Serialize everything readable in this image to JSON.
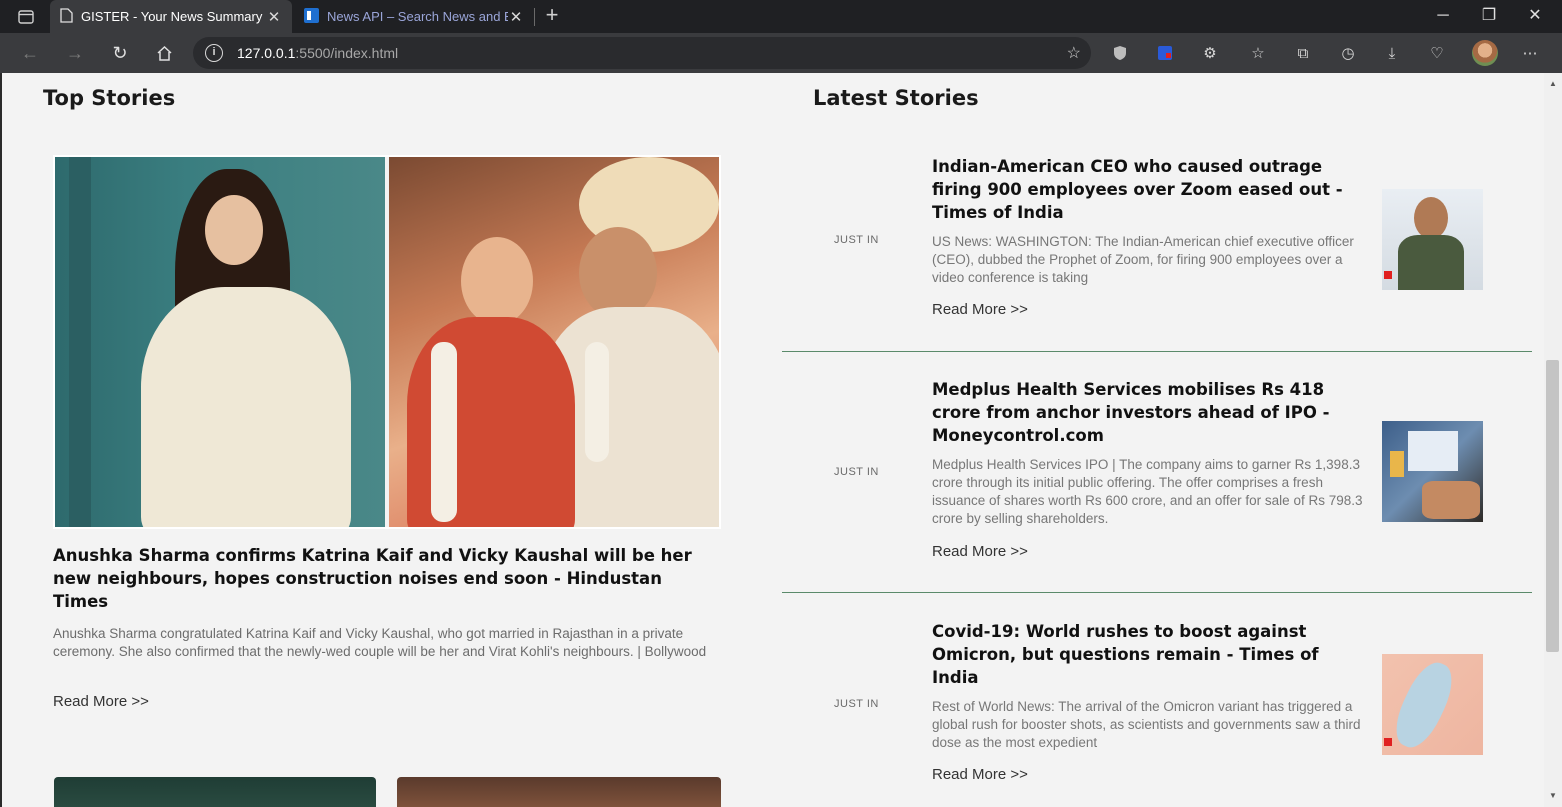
{
  "browser": {
    "tabs": [
      {
        "title": "GISTER - Your News Summary",
        "active": true
      },
      {
        "title": "News API – Search News and Blo",
        "active": false
      }
    ],
    "address": {
      "host": "127.0.0.1",
      "path": ":5500/index.html"
    }
  },
  "page": {
    "top_stories": {
      "heading": "Top Stories",
      "main": {
        "title": "Anushka Sharma confirms Katrina Kaif and Vicky Kaushal will be her new neighbours, hopes construction noises end soon - Hindustan Times",
        "description": "Anushka Sharma congratulated Katrina Kaif and Vicky Kaushal, who got married in Rajasthan in a private ceremony. She also confirmed that the newly-wed couple will be her and Virat Kohli's neighbours. | Bollywood",
        "read_more": "Read More >>"
      }
    },
    "latest_stories": {
      "heading": "Latest Stories",
      "items": [
        {
          "tag": "JUST IN",
          "title": "Indian-American CEO who caused outrage firing 900 employees over Zoom eased out - Times of India",
          "description": "US News: WASHINGTON: The Indian-American chief executive officer (CEO), dubbed the Prophet of Zoom, for firing 900 employees over a video conference is taking",
          "read_more": "Read More >>"
        },
        {
          "tag": "JUST IN",
          "title": "Medplus Health Services mobilises Rs 418 crore from anchor investors ahead of IPO - Moneycontrol.com",
          "description": "Medplus Health Services IPO | The company aims to garner Rs 1,398.3 crore through its initial public offering. The offer comprises a fresh issuance of shares worth Rs 600 crore, and an offer for sale of Rs 798.3 crore by selling shareholders.",
          "read_more": "Read More >>"
        },
        {
          "tag": "JUST IN",
          "title": "Covid-19: World rushes to boost against Omicron, but questions remain - Times of India",
          "description": "Rest of World News: The arrival of the Omicron variant has triggered a global rush for booster shots, as scientists and governments saw a third dose as the most expedient",
          "read_more": "Read More >>"
        }
      ]
    }
  },
  "colors": {
    "tabbar": "#1f2023",
    "toolbar": "#3a3b3e",
    "page_background": "#f3f3f3",
    "divider": "#5a8a6a"
  }
}
